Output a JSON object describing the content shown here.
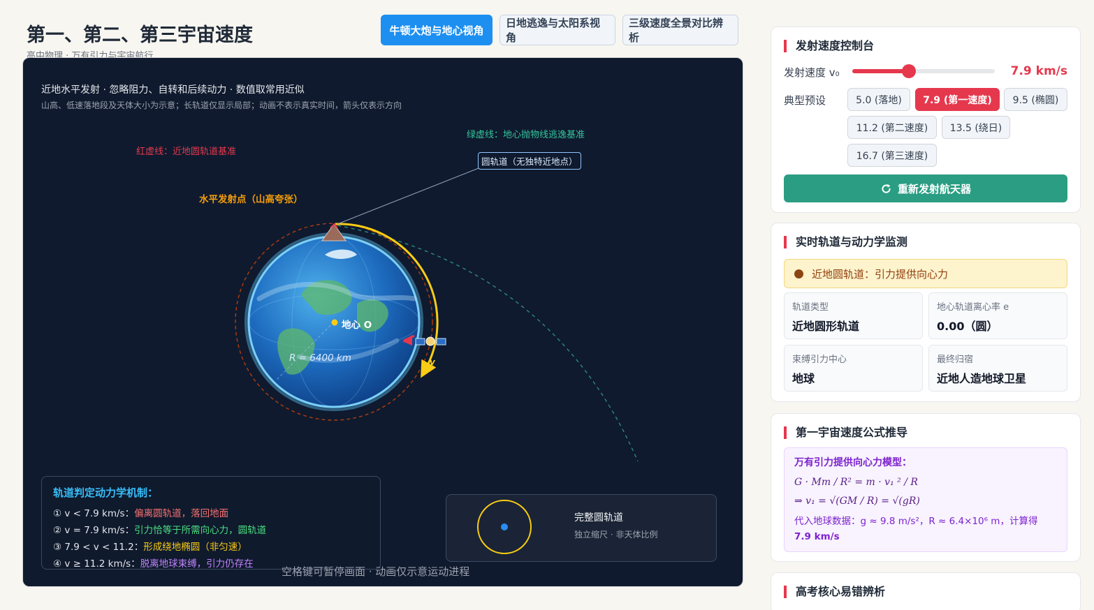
{
  "header": {
    "title": "第一、第二、第三宇宙速度",
    "subtitle": "高中物理 · 万有引力与宇宙航行"
  },
  "tabs": [
    {
      "label": "牛顿大炮与地心视角",
      "active": true
    },
    {
      "label": "日地逃逸与太阳系视角",
      "active": false
    },
    {
      "label": "三级速度全景对比辨析",
      "active": false
    }
  ],
  "stage": {
    "info_line1": "近地水平发射 · 忽略阻力、自转和后续动力 · 数值取常用近似",
    "info_line2": "山高、低速落地段及天体大小为示意；长轨道仅显示局部；动画不表示真实时间，箭头仅表示方向",
    "labels": {
      "red_dashed": "红虚线：近地圆轨道基准",
      "green_dashed": "绿虚线：地心抛物线逃逸基准",
      "circle_orbit": "圆轨道（无独特近地点）",
      "launch_point": "水平发射点（山高夸张）",
      "earth_center": "地心 O",
      "radius": "R = 6400 km",
      "velocity": "v"
    },
    "mechanism": {
      "title": "轨道判定动力学机制：",
      "rows": [
        {
          "cond": "① v < 7.9 km/s：",
          "result": "偏离圆轨道，落回地面"
        },
        {
          "cond": "② v = 7.9 km/s：",
          "result": "引力恰等于所需向心力，圆轨道"
        },
        {
          "cond": "③ 7.9 < v < 11.2：",
          "result": "形成绕地椭圆（非匀速）"
        },
        {
          "cond": "④ v ≥ 11.2 km/s：",
          "result": "脱离地球束缚，引力仍存在"
        }
      ]
    },
    "inset": {
      "title": "完整圆轨道",
      "subtitle": "独立缩尺 · 非天体比例"
    },
    "pause_note": "空格键可暂停画面 · 动画仅示意运动进程"
  },
  "control": {
    "title": "发射速度控制台",
    "speed_label": "发射速度 v₀",
    "speed_value": "7.9 km/s",
    "slider": {
      "min": 0,
      "max": 20,
      "value": 7.9
    },
    "preset_label": "典型预设",
    "presets": [
      {
        "label": "5.0 (落地)",
        "active": false
      },
      {
        "label": "7.9 (第一速度)",
        "active": true
      },
      {
        "label": "9.5 (椭圆)",
        "active": false
      },
      {
        "label": "11.2 (第二速度)",
        "active": false
      },
      {
        "label": "13.5 (绕日)",
        "active": false
      },
      {
        "label": "16.7 (第三速度)",
        "active": false
      }
    ],
    "reset_label": "重新发射航天器"
  },
  "monitor": {
    "title": "实时轨道与动力学监测",
    "status": "近地圆轨道：引力提供向心力",
    "cells": [
      {
        "key": "轨道类型",
        "value": "近地圆形轨道"
      },
      {
        "key": "地心轨道离心率 e",
        "value": "0.00（圆）"
      },
      {
        "key": "束缚引力中心",
        "value": "地球"
      },
      {
        "key": "最终归宿",
        "value": "近地人造地球卫星"
      }
    ]
  },
  "formula": {
    "title": "第一宇宙速度公式推导",
    "model": "万有引力提供向心力模型：",
    "line1": "G · Mm / R² = m · v₁   ² / R",
    "line2": "⇒ v₁    = √(GM / R) = √(gR)",
    "note": "代入地球数据：g ≈ 9.8 m/s²，R ≈ 6.4×10⁶ m，计算得",
    "result": "7.9 km/s"
  },
  "pitfalls": {
    "title": "高考核心易错辨析"
  },
  "colors": {
    "accent": "#e5384d",
    "tab_active": "#1d8ff0",
    "reset": "#2a9d82",
    "stage_bg": "#0f1a2e"
  }
}
